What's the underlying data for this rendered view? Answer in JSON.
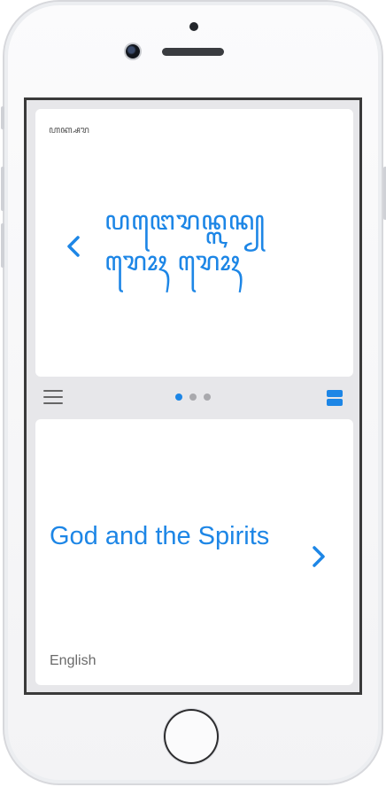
{
  "header_script": "ꦲꦏ꧀ꦱꦫ",
  "main_script_lines": [
    "ꦥꦔꦺꦫꦤ꧀ꦭꦤ꧀",
    "ꦫꦺꦴꦃ ꦫꦺꦴꦃ"
  ],
  "pager": {
    "pages": 3,
    "active": 0
  },
  "card": {
    "title": "God and the Spirits",
    "language": "English"
  },
  "icons": {
    "prev": "chevron-left-icon",
    "next": "chevron-right-icon",
    "menu": "hamburger-menu-icon",
    "view": "split-view-icon"
  },
  "colors": {
    "accent": "#1d86e6",
    "background": "#e7e7ea",
    "card": "#ffffff"
  }
}
